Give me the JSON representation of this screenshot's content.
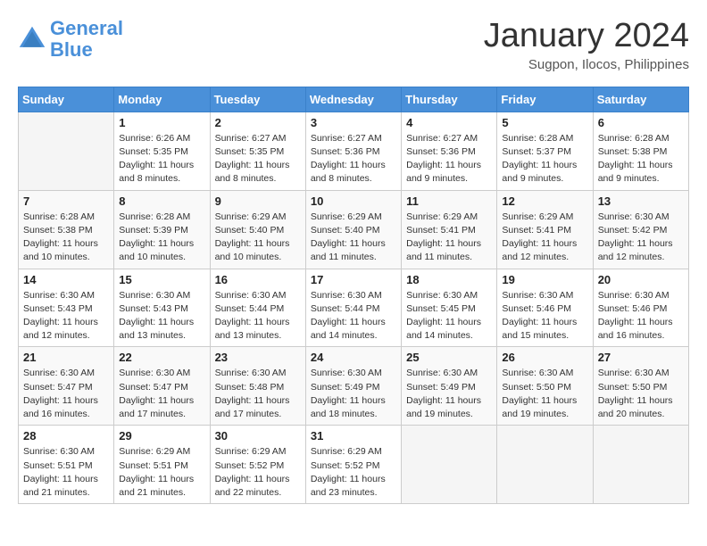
{
  "header": {
    "logo_general": "General",
    "logo_blue": "Blue",
    "month_title": "January 2024",
    "subtitle": "Sugpon, Ilocos, Philippines"
  },
  "columns": [
    "Sunday",
    "Monday",
    "Tuesday",
    "Wednesday",
    "Thursday",
    "Friday",
    "Saturday"
  ],
  "weeks": [
    [
      {
        "day": "",
        "info": ""
      },
      {
        "day": "1",
        "info": "Sunrise: 6:26 AM\nSunset: 5:35 PM\nDaylight: 11 hours\nand 8 minutes."
      },
      {
        "day": "2",
        "info": "Sunrise: 6:27 AM\nSunset: 5:35 PM\nDaylight: 11 hours\nand 8 minutes."
      },
      {
        "day": "3",
        "info": "Sunrise: 6:27 AM\nSunset: 5:36 PM\nDaylight: 11 hours\nand 8 minutes."
      },
      {
        "day": "4",
        "info": "Sunrise: 6:27 AM\nSunset: 5:36 PM\nDaylight: 11 hours\nand 9 minutes."
      },
      {
        "day": "5",
        "info": "Sunrise: 6:28 AM\nSunset: 5:37 PM\nDaylight: 11 hours\nand 9 minutes."
      },
      {
        "day": "6",
        "info": "Sunrise: 6:28 AM\nSunset: 5:38 PM\nDaylight: 11 hours\nand 9 minutes."
      }
    ],
    [
      {
        "day": "7",
        "info": "Sunrise: 6:28 AM\nSunset: 5:38 PM\nDaylight: 11 hours\nand 10 minutes."
      },
      {
        "day": "8",
        "info": "Sunrise: 6:28 AM\nSunset: 5:39 PM\nDaylight: 11 hours\nand 10 minutes."
      },
      {
        "day": "9",
        "info": "Sunrise: 6:29 AM\nSunset: 5:40 PM\nDaylight: 11 hours\nand 10 minutes."
      },
      {
        "day": "10",
        "info": "Sunrise: 6:29 AM\nSunset: 5:40 PM\nDaylight: 11 hours\nand 11 minutes."
      },
      {
        "day": "11",
        "info": "Sunrise: 6:29 AM\nSunset: 5:41 PM\nDaylight: 11 hours\nand 11 minutes."
      },
      {
        "day": "12",
        "info": "Sunrise: 6:29 AM\nSunset: 5:41 PM\nDaylight: 11 hours\nand 12 minutes."
      },
      {
        "day": "13",
        "info": "Sunrise: 6:30 AM\nSunset: 5:42 PM\nDaylight: 11 hours\nand 12 minutes."
      }
    ],
    [
      {
        "day": "14",
        "info": "Sunrise: 6:30 AM\nSunset: 5:43 PM\nDaylight: 11 hours\nand 12 minutes."
      },
      {
        "day": "15",
        "info": "Sunrise: 6:30 AM\nSunset: 5:43 PM\nDaylight: 11 hours\nand 13 minutes."
      },
      {
        "day": "16",
        "info": "Sunrise: 6:30 AM\nSunset: 5:44 PM\nDaylight: 11 hours\nand 13 minutes."
      },
      {
        "day": "17",
        "info": "Sunrise: 6:30 AM\nSunset: 5:44 PM\nDaylight: 11 hours\nand 14 minutes."
      },
      {
        "day": "18",
        "info": "Sunrise: 6:30 AM\nSunset: 5:45 PM\nDaylight: 11 hours\nand 14 minutes."
      },
      {
        "day": "19",
        "info": "Sunrise: 6:30 AM\nSunset: 5:46 PM\nDaylight: 11 hours\nand 15 minutes."
      },
      {
        "day": "20",
        "info": "Sunrise: 6:30 AM\nSunset: 5:46 PM\nDaylight: 11 hours\nand 16 minutes."
      }
    ],
    [
      {
        "day": "21",
        "info": "Sunrise: 6:30 AM\nSunset: 5:47 PM\nDaylight: 11 hours\nand 16 minutes."
      },
      {
        "day": "22",
        "info": "Sunrise: 6:30 AM\nSunset: 5:47 PM\nDaylight: 11 hours\nand 17 minutes."
      },
      {
        "day": "23",
        "info": "Sunrise: 6:30 AM\nSunset: 5:48 PM\nDaylight: 11 hours\nand 17 minutes."
      },
      {
        "day": "24",
        "info": "Sunrise: 6:30 AM\nSunset: 5:49 PM\nDaylight: 11 hours\nand 18 minutes."
      },
      {
        "day": "25",
        "info": "Sunrise: 6:30 AM\nSunset: 5:49 PM\nDaylight: 11 hours\nand 19 minutes."
      },
      {
        "day": "26",
        "info": "Sunrise: 6:30 AM\nSunset: 5:50 PM\nDaylight: 11 hours\nand 19 minutes."
      },
      {
        "day": "27",
        "info": "Sunrise: 6:30 AM\nSunset: 5:50 PM\nDaylight: 11 hours\nand 20 minutes."
      }
    ],
    [
      {
        "day": "28",
        "info": "Sunrise: 6:30 AM\nSunset: 5:51 PM\nDaylight: 11 hours\nand 21 minutes."
      },
      {
        "day": "29",
        "info": "Sunrise: 6:29 AM\nSunset: 5:51 PM\nDaylight: 11 hours\nand 21 minutes."
      },
      {
        "day": "30",
        "info": "Sunrise: 6:29 AM\nSunset: 5:52 PM\nDaylight: 11 hours\nand 22 minutes."
      },
      {
        "day": "31",
        "info": "Sunrise: 6:29 AM\nSunset: 5:52 PM\nDaylight: 11 hours\nand 23 minutes."
      },
      {
        "day": "",
        "info": ""
      },
      {
        "day": "",
        "info": ""
      },
      {
        "day": "",
        "info": ""
      }
    ]
  ]
}
